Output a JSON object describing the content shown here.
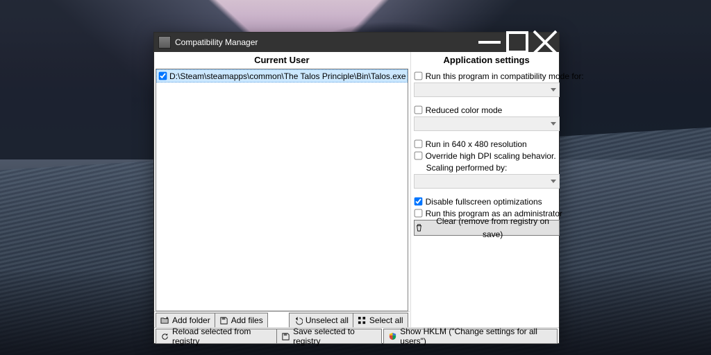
{
  "window": {
    "title": "Compatibility Manager"
  },
  "left": {
    "heading": "Current User",
    "item_label": "D:\\Steam\\steamapps\\common\\The Talos Principle\\Bin\\Talos.exe",
    "item_checked": true
  },
  "right": {
    "heading": "Application settings",
    "compat_mode": {
      "label": "Run this program in compatibility mode for:",
      "checked": false
    },
    "reduced_color": {
      "label": "Reduced color mode",
      "checked": false
    },
    "run_640": {
      "label": "Run in 640 x 480 resolution",
      "checked": false
    },
    "override_dpi": {
      "label": "Override high DPI scaling behavior.",
      "checked": false
    },
    "scaling_by": {
      "label": "Scaling performed by:"
    },
    "disable_fs": {
      "label": "Disable fullscreen optimizations",
      "checked": true
    },
    "run_admin": {
      "label": "Run this program as an administrator",
      "checked": false
    },
    "clear": {
      "label": "Clear (remove from registry on save)"
    }
  },
  "bar1": {
    "add_folder": "Add folder",
    "add_files": "Add files",
    "unselect_all": "Unselect all",
    "select_all": "Select all"
  },
  "bar2": {
    "reload": "Reload selected from registry",
    "save": "Save selected to registry",
    "show_hklm": "Show HKLM (\"Change settings for all users\")"
  }
}
